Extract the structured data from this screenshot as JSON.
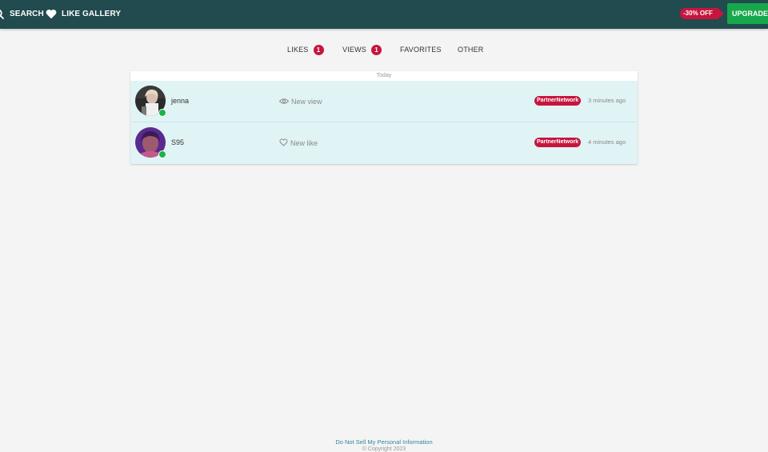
{
  "header": {
    "nav": [
      {
        "label": "SEARCH",
        "icon": "search-icon"
      },
      {
        "label": "LIKE GALLERY",
        "icon": "heart-icon"
      }
    ],
    "discount": "-30% OFF",
    "upgrade_label": "UPGRADE NOW"
  },
  "tabs": [
    {
      "label": "LIKES",
      "count": "1"
    },
    {
      "label": "VIEWS",
      "count": "1"
    },
    {
      "label": "FAVORITES"
    },
    {
      "label": "OTHER"
    }
  ],
  "list": {
    "date_header": "Today",
    "items": [
      {
        "name": "jenna",
        "activity": "New view",
        "activity_icon": "eye-icon",
        "source": "PartnerNetwork",
        "time": "3 minutes ago",
        "online": true
      },
      {
        "name": "S95",
        "activity": "New like",
        "activity_icon": "heart-outline-icon",
        "source": "PartnerNetwork",
        "time": "4 minutes ago",
        "online": true
      }
    ]
  },
  "footer": {
    "privacy_link": "Do Not Sell My Personal Information",
    "copyright": "© Copyright 2023"
  },
  "colors": {
    "header_bg": "#214b4e",
    "accent_red": "#c7153d",
    "upgrade_green": "#16a84a",
    "row_bg": "#e0f3f5",
    "online_green": "#18b449",
    "link": "#2a8a9a"
  }
}
